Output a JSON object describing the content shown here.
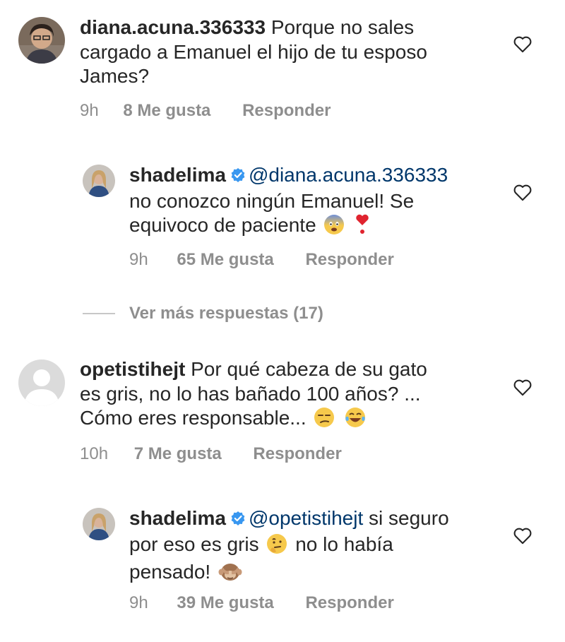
{
  "comments": [
    {
      "username": "diana.acuna.336333",
      "text": "Porque no sales cargado a Emanuel el hijo de tu esposo James?",
      "time": "9h",
      "likes": "8 Me gusta",
      "reply": "Responder"
    },
    {
      "username": "shadelima",
      "verified": true,
      "mention": "@diana.acuna.336333",
      "text_line1": "no conozco ningún Emanuel! Se",
      "text_line2": "equivoco de paciente",
      "emojis": [
        "anxious-face",
        "heart-exclamation"
      ],
      "time": "9h",
      "likes": "65 Me gusta",
      "reply": "Responder"
    },
    {
      "view_more": "Ver más respuestas (17)"
    },
    {
      "username": "opetistihejt",
      "text_line1": "Por qué cabeza de su gato",
      "text_line2": "es gris, no lo has bañado 100 años? ...",
      "text_line3": "Cómo eres responsable...",
      "emojis": [
        "unamused-face",
        "tears-of-joy-face"
      ],
      "time": "10h",
      "likes": "7 Me gusta",
      "reply": "Responder"
    },
    {
      "username": "shadelima",
      "verified": true,
      "mention": "@opetistihejt",
      "text_line1": "si seguro",
      "text_line2a": "por eso es gris",
      "text_line2b": "no lo había",
      "text_line3": "pensado!",
      "emojis": [
        "thinking-face",
        "see-no-evil-monkey"
      ],
      "time": "9h",
      "likes": "39 Me gusta",
      "reply": "Responder"
    }
  ],
  "colors": {
    "text": "#262626",
    "secondary": "#8e8e8e",
    "mention": "#00376b",
    "verified": "#3897f0"
  },
  "icons": [
    "heart-outline-icon",
    "verified-badge-icon"
  ]
}
